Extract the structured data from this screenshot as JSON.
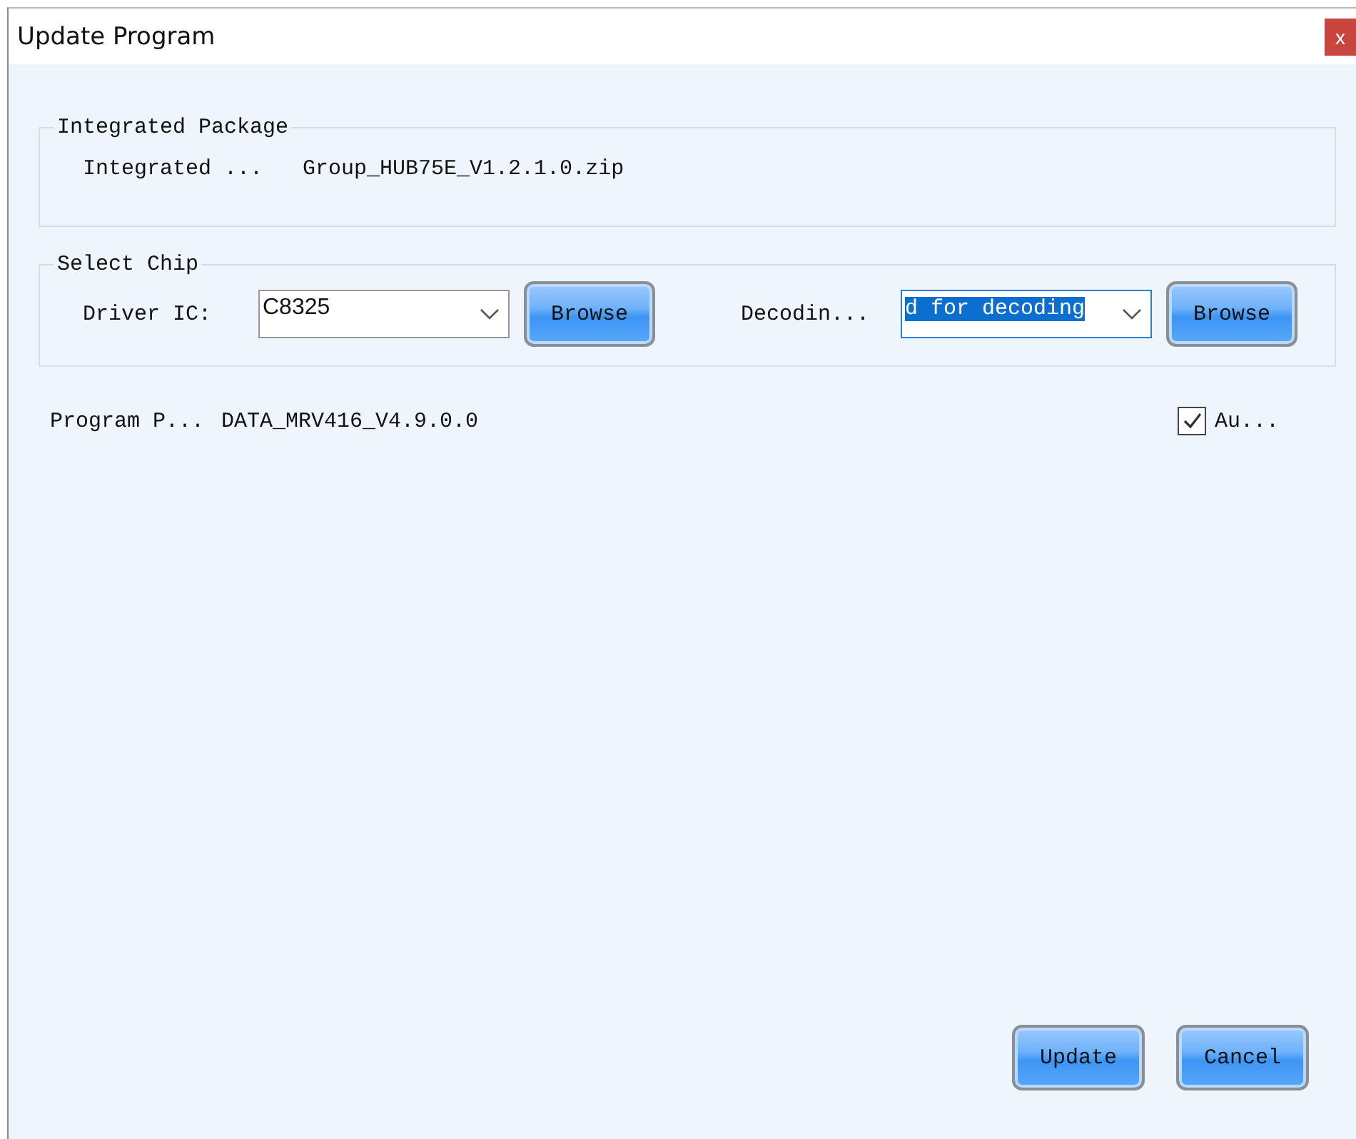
{
  "window": {
    "title": "Update Program",
    "close": "x"
  },
  "integrated_package": {
    "title": "Integrated Package",
    "label": "Integrated ...",
    "value": "Group_HUB75E_V1.2.1.0.zip"
  },
  "select_chip": {
    "title": "Select Chip",
    "driver_label": "Driver IC:",
    "driver_value": "C8325",
    "driver_button": "Browse",
    "decoding_label": "Decodin...",
    "decoding_value": "d for decoding",
    "decoding_button": "Browse"
  },
  "program_path": {
    "label": "Program P...",
    "value": "DATA_MRV416_V4.9.0.0"
  },
  "auto_checkbox": {
    "label": "Au...",
    "checked": true
  },
  "buttons": [
    "Update",
    "Cancel"
  ]
}
